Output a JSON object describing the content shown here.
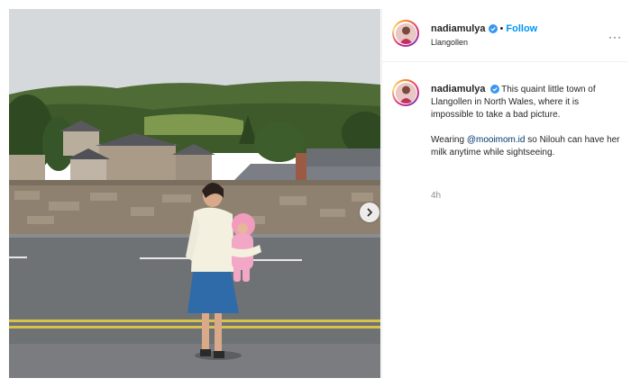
{
  "post": {
    "username": "nadiamulya",
    "follow_label": "Follow",
    "separator": "•",
    "location": "Llangollen",
    "more_label": "···"
  },
  "caption": {
    "username": "nadiamulya",
    "text1": "This quaint little town of Llangollen in North Wales, where it is impossible to take a bad picture.",
    "text2_before": "Wearing ",
    "mention": "@mooimom.id",
    "text2_after": " so Nilouh can have her milk anytime while sightseeing.",
    "time": "4h"
  },
  "colors": {
    "follow": "#0095f6",
    "verified": "#3897f0",
    "mention": "#00376b",
    "meta": "#8e8e8e"
  },
  "icons": {
    "verified": "verified-badge-icon",
    "next": "chevron-right-icon",
    "more": "more-options-icon"
  }
}
